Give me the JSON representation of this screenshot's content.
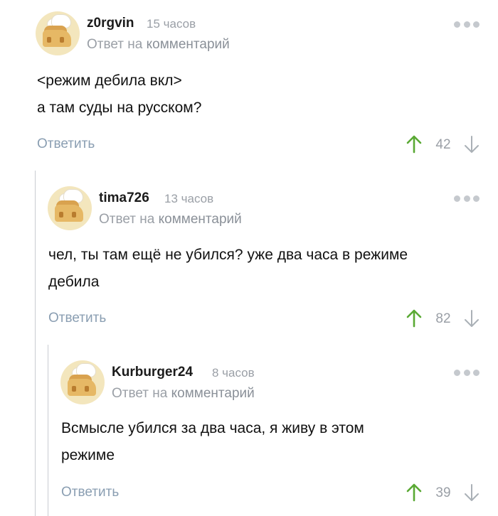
{
  "colors": {
    "up_arrow": "#5aa934",
    "down_arrow": "#aab0b6",
    "reply_link": "#8a9eb2",
    "thread_line": "#c9ccd1"
  },
  "comments": [
    {
      "author": "z0rgvin",
      "time": "15 часов",
      "reply_prefix": "Ответ на",
      "reply_link": "комментарий",
      "lines": [
        "<режим дебила вкл>",
        "а там суды на русском?"
      ],
      "reply_label": "Ответить",
      "rating": "42",
      "icons": {
        "more": "more-dots-icon",
        "up": "arrow-up-icon",
        "down": "arrow-down-icon",
        "avatar": "avatar-chef-house"
      }
    },
    {
      "author": "tima726",
      "time": "13 часов",
      "reply_prefix": "Ответ на",
      "reply_link": "комментарий",
      "lines": [
        "чел, ты там ещё не убился? уже два часа в режиме",
        "дебила"
      ],
      "reply_label": "Ответить",
      "rating": "82",
      "icons": {
        "more": "more-dots-icon",
        "up": "arrow-up-icon",
        "down": "arrow-down-icon",
        "avatar": "avatar-chef-house"
      }
    },
    {
      "author": "Kurburger24",
      "time": "8 часов",
      "reply_prefix": "Ответ на",
      "reply_link": "комментарий",
      "lines": [
        "Всмысле убился за два часа, я живу в этом",
        "режиме"
      ],
      "reply_label": "Ответить",
      "rating": "39",
      "icons": {
        "more": "more-dots-icon",
        "up": "arrow-up-icon",
        "down": "arrow-down-icon",
        "avatar": "avatar-chef-house"
      }
    }
  ]
}
